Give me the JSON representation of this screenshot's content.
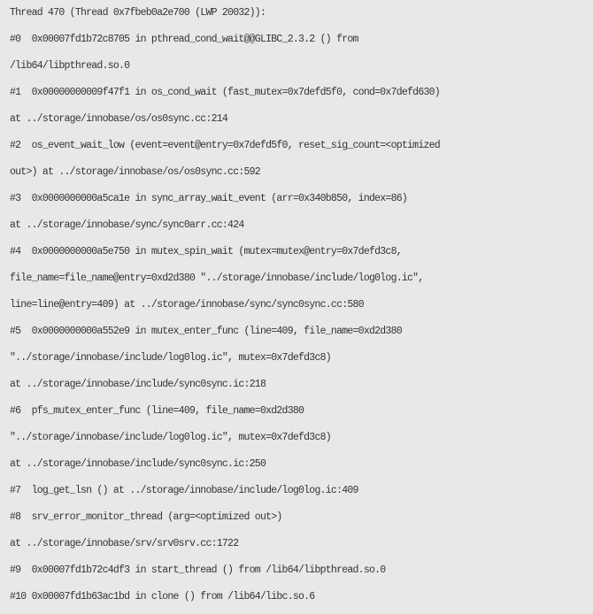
{
  "code_block": {
    "lines": [
      "Thread 470 (Thread 0x7fbeb0a2e700 (LWP 20032)):",
      "#0  0x00007fd1b72c8705 in pthread_cond_wait@@GLIBC_2.3.2 () from",
      "/lib64/libpthread.so.0",
      "#1  0x00000000009f47f1 in os_cond_wait (fast_mutex=0x7defd5f0, cond=0x7defd630)",
      "at ../storage/innobase/os/os0sync.cc:214",
      "#2  os_event_wait_low (event=event@entry=0x7defd5f0, reset_sig_count=<optimized",
      "out>) at ../storage/innobase/os/os0sync.cc:592",
      "#3  0x0000000000a5ca1e in sync_array_wait_event (arr=0x340b850, index=86)",
      "at ../storage/innobase/sync/sync0arr.cc:424",
      "#4  0x0000000000a5e750 in mutex_spin_wait (mutex=mutex@entry=0x7defd3c8,",
      "file_name=file_name@entry=0xd2d380 \"../storage/innobase/include/log0log.ic\",",
      "line=line@entry=409) at ../storage/innobase/sync/sync0sync.cc:580",
      "#5  0x0000000000a552e9 in mutex_enter_func (line=409, file_name=0xd2d380",
      "\"../storage/innobase/include/log0log.ic\", mutex=0x7defd3c8)",
      "at ../storage/innobase/include/sync0sync.ic:218",
      "#6  pfs_mutex_enter_func (line=409, file_name=0xd2d380",
      "\"../storage/innobase/include/log0log.ic\", mutex=0x7defd3c8)",
      "at ../storage/innobase/include/sync0sync.ic:250",
      "#7  log_get_lsn () at ../storage/innobase/include/log0log.ic:409",
      "#8  srv_error_monitor_thread (arg=<optimized out>)",
      "at ../storage/innobase/srv/srv0srv.cc:1722",
      "#9  0x00007fd1b72c4df3 in start_thread () from /lib64/libpthread.so.0",
      "#10 0x00007fd1b63ac1bd in clone () from /lib64/libc.so.6"
    ]
  }
}
